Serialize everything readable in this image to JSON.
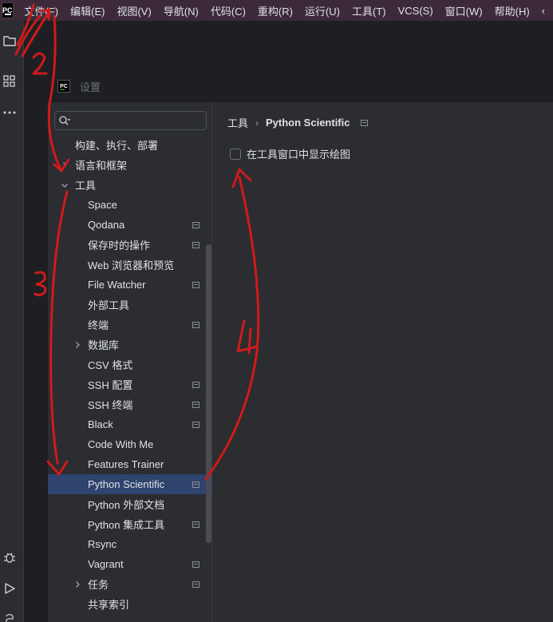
{
  "app": {
    "logo_text": "PC"
  },
  "menubar": {
    "items": [
      "文件(F)",
      "编辑(E)",
      "视图(V)",
      "导航(N)",
      "代码(C)",
      "重构(R)",
      "运行(U)",
      "工具(T)",
      "VCS(S)",
      "窗口(W)",
      "帮助(H)",
      "‹"
    ]
  },
  "toolstrip": {
    "icons": [
      "folder-icon",
      "structure-icon",
      "more-icon",
      "debug-icon",
      "run-icon",
      "python-console-icon"
    ]
  },
  "dialog": {
    "title": "设置",
    "search": {
      "value": "",
      "placeholder": ""
    },
    "tree": [
      {
        "label": "构建、执行、部署",
        "indent": 0,
        "arrow": "none",
        "project_icon": false,
        "selected": false
      },
      {
        "label": "语言和框架",
        "indent": 0,
        "arrow": "right",
        "project_icon": false,
        "selected": false
      },
      {
        "label": "工具",
        "indent": 0,
        "arrow": "down",
        "project_icon": false,
        "selected": false
      },
      {
        "label": "Space",
        "indent": 1,
        "arrow": "none",
        "project_icon": false,
        "selected": false
      },
      {
        "label": "Qodana",
        "indent": 1,
        "arrow": "none",
        "project_icon": true,
        "selected": false
      },
      {
        "label": "保存时的操作",
        "indent": 1,
        "arrow": "none",
        "project_icon": true,
        "selected": false
      },
      {
        "label": "Web 浏览器和预览",
        "indent": 1,
        "arrow": "none",
        "project_icon": false,
        "selected": false
      },
      {
        "label": "File Watcher",
        "indent": 1,
        "arrow": "none",
        "project_icon": true,
        "selected": false
      },
      {
        "label": "外部工具",
        "indent": 1,
        "arrow": "none",
        "project_icon": false,
        "selected": false
      },
      {
        "label": "终端",
        "indent": 1,
        "arrow": "none",
        "project_icon": true,
        "selected": false
      },
      {
        "label": "数据库",
        "indent": 1,
        "arrow": "right",
        "project_icon": false,
        "selected": false
      },
      {
        "label": "CSV 格式",
        "indent": 1,
        "arrow": "none",
        "project_icon": false,
        "selected": false
      },
      {
        "label": "SSH 配置",
        "indent": 1,
        "arrow": "none",
        "project_icon": true,
        "selected": false
      },
      {
        "label": "SSH 终端",
        "indent": 1,
        "arrow": "none",
        "project_icon": true,
        "selected": false
      },
      {
        "label": "Black",
        "indent": 1,
        "arrow": "none",
        "project_icon": true,
        "selected": false
      },
      {
        "label": "Code With Me",
        "indent": 1,
        "arrow": "none",
        "project_icon": false,
        "selected": false
      },
      {
        "label": "Features Trainer",
        "indent": 1,
        "arrow": "none",
        "project_icon": false,
        "selected": false
      },
      {
        "label": "Python Scientific",
        "indent": 1,
        "arrow": "none",
        "project_icon": true,
        "selected": true
      },
      {
        "label": "Python 外部文档",
        "indent": 1,
        "arrow": "none",
        "project_icon": false,
        "selected": false
      },
      {
        "label": "Python 集成工具",
        "indent": 1,
        "arrow": "none",
        "project_icon": true,
        "selected": false
      },
      {
        "label": "Rsync",
        "indent": 1,
        "arrow": "none",
        "project_icon": false,
        "selected": false
      },
      {
        "label": "Vagrant",
        "indent": 1,
        "arrow": "none",
        "project_icon": true,
        "selected": false
      },
      {
        "label": "任务",
        "indent": 1,
        "arrow": "right",
        "project_icon": true,
        "selected": false
      },
      {
        "label": "共享索引",
        "indent": 1,
        "arrow": "none",
        "project_icon": false,
        "selected": false
      }
    ],
    "breadcrumb": {
      "parent": "工具",
      "separator": "›",
      "current": "Python Scientific"
    },
    "option": {
      "label": "在工具窗口中显示绘图",
      "checked": false
    }
  },
  "annotations": {
    "color": "#d01a1a",
    "labels": [
      "1",
      "2",
      "3",
      "4"
    ]
  }
}
